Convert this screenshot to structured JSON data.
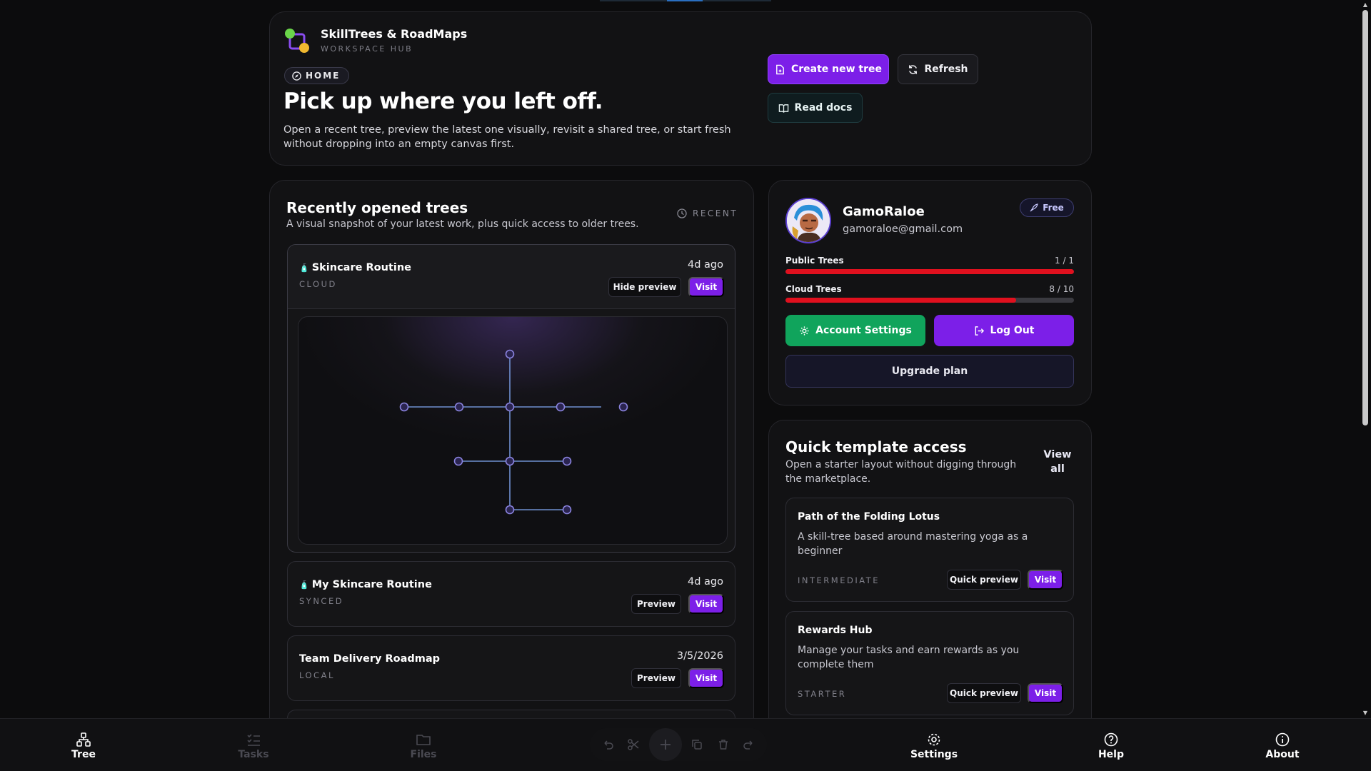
{
  "header": {
    "brand_title": "SkillTrees & RoadMaps",
    "brand_subtitle": "WORKSPACE HUB",
    "home_label": "HOME",
    "hero_title": "Pick up where you left off.",
    "hero_description": "Open a recent tree, preview the latest one visually, revisit a shared tree, or start fresh without dropping into an empty canvas first.",
    "create_label": "Create new tree",
    "refresh_label": "Refresh",
    "docs_label": "Read docs"
  },
  "recent": {
    "title": "Recently opened trees",
    "subtitle": "A visual snapshot of your latest work, plus quick access to older trees.",
    "tag": "RECENT",
    "items": [
      {
        "name": "Skincare Routine",
        "sub": "CLOUD",
        "time": "4d ago",
        "preview_label": "Hide preview",
        "visit_label": "Visit",
        "emoji": "🧴"
      },
      {
        "name": "My Skincare Routine",
        "sub": "SYNCED",
        "time": "4d ago",
        "preview_label": "Preview",
        "visit_label": "Visit",
        "emoji": "🧴"
      },
      {
        "name": "Team Delivery Roadmap",
        "sub": "LOCAL",
        "time": "3/5/2026",
        "preview_label": "Preview",
        "visit_label": "Visit"
      }
    ]
  },
  "profile": {
    "name": "GamoRaloe",
    "email": "gamoraloe@gmail.com",
    "plan": "Free",
    "public_label": "Public Trees",
    "public_count": "1 / 1",
    "public_fraction": 1.0,
    "cloud_label": "Cloud Trees",
    "cloud_count": "8 / 10",
    "cloud_fraction": 0.8,
    "account_settings_label": "Account Settings",
    "logout_label": "Log Out",
    "upgrade_label": "Upgrade plan"
  },
  "templates": {
    "title": "Quick template access",
    "subtitle": "Open a starter layout without digging through the marketplace.",
    "view_all_line1": "View",
    "view_all_line2": "all",
    "items": [
      {
        "name": "Path of the Folding Lotus",
        "desc": "A skill-tree based around mastering yoga as a beginner",
        "level": "INTERMEDIATE",
        "preview_label": "Quick preview",
        "visit_label": "Visit"
      },
      {
        "name": "Rewards Hub",
        "desc": "Manage your tasks and earn rewards as you complete them",
        "level": "STARTER",
        "preview_label": "Quick preview",
        "visit_label": "Visit"
      }
    ]
  },
  "nav": {
    "tree": "Tree",
    "tasks": "Tasks",
    "files": "Files",
    "settings": "Settings",
    "help": "Help",
    "about": "About"
  },
  "colors": {
    "accent": "#7c1fe8",
    "success": "#10a45c",
    "usage_bar": "#e0101e",
    "tree_node": "#8b84e0"
  }
}
